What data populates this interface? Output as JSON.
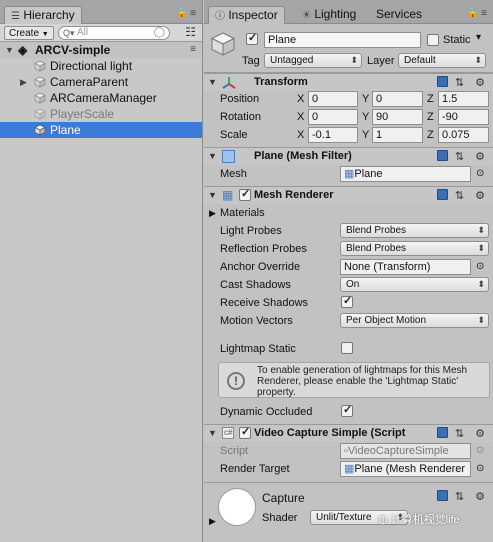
{
  "hierarchy": {
    "tab_label": "Hierarchy",
    "create_label": "Create",
    "search_placeholder": "All",
    "scene_name": "ARCV-simple",
    "items": [
      {
        "label": "Directional light"
      },
      {
        "label": "CameraParent"
      },
      {
        "label": "ARCameraManager"
      },
      {
        "label": "PlayerScale"
      },
      {
        "label": "Plane"
      }
    ]
  },
  "inspector": {
    "tabs": [
      "Inspector",
      "Lighting",
      "Services"
    ],
    "object_name": "Plane",
    "static_label": "Static",
    "tag_label": "Tag",
    "tag_value": "Untagged",
    "layer_label": "Layer",
    "layer_value": "Default"
  },
  "transform": {
    "title": "Transform",
    "position_label": "Position",
    "rotation_label": "Rotation",
    "scale_label": "Scale",
    "axis_labels": [
      "X",
      "Y",
      "Z"
    ],
    "position": [
      "0",
      "0",
      "1.5"
    ],
    "rotation": [
      "0",
      "90",
      "-90"
    ],
    "scale": [
      "-0.1",
      "1",
      "0.075"
    ]
  },
  "mesh_filter": {
    "title": "Plane (Mesh Filter)",
    "mesh_label": "Mesh",
    "mesh_value": "Plane"
  },
  "mesh_renderer": {
    "title": "Mesh Renderer",
    "materials_label": "Materials",
    "light_probes_label": "Light Probes",
    "light_probes_value": "Blend Probes",
    "reflection_probes_label": "Reflection Probes",
    "reflection_probes_value": "Blend Probes",
    "anchor_override_label": "Anchor Override",
    "anchor_override_value": "None (Transform)",
    "cast_shadows_label": "Cast Shadows",
    "cast_shadows_value": "On",
    "receive_shadows_label": "Receive Shadows",
    "motion_vectors_label": "Motion Vectors",
    "motion_vectors_value": "Per Object Motion",
    "lightmap_static_label": "Lightmap Static",
    "help_text": "To enable generation of lightmaps for this Mesh Renderer, please enable the 'Lightmap Static' property.",
    "dynamic_occluded_label": "Dynamic Occluded"
  },
  "video_capture": {
    "title": "Video Capture Simple (Script",
    "script_label": "Script",
    "script_value": "VideoCaptureSimple",
    "render_target_label": "Render Target",
    "render_target_value": "Plane (Mesh Renderer"
  },
  "material": {
    "name": "Capture",
    "shader_label": "Shader",
    "shader_value": "Unlit/Texture"
  },
  "watermark": {
    "text": "计算机视觉life"
  },
  "colors": {
    "selection": "#3d7bd9",
    "panel_bg": "#c2c2c2",
    "toolbar_bg": "#a5a5a5"
  }
}
